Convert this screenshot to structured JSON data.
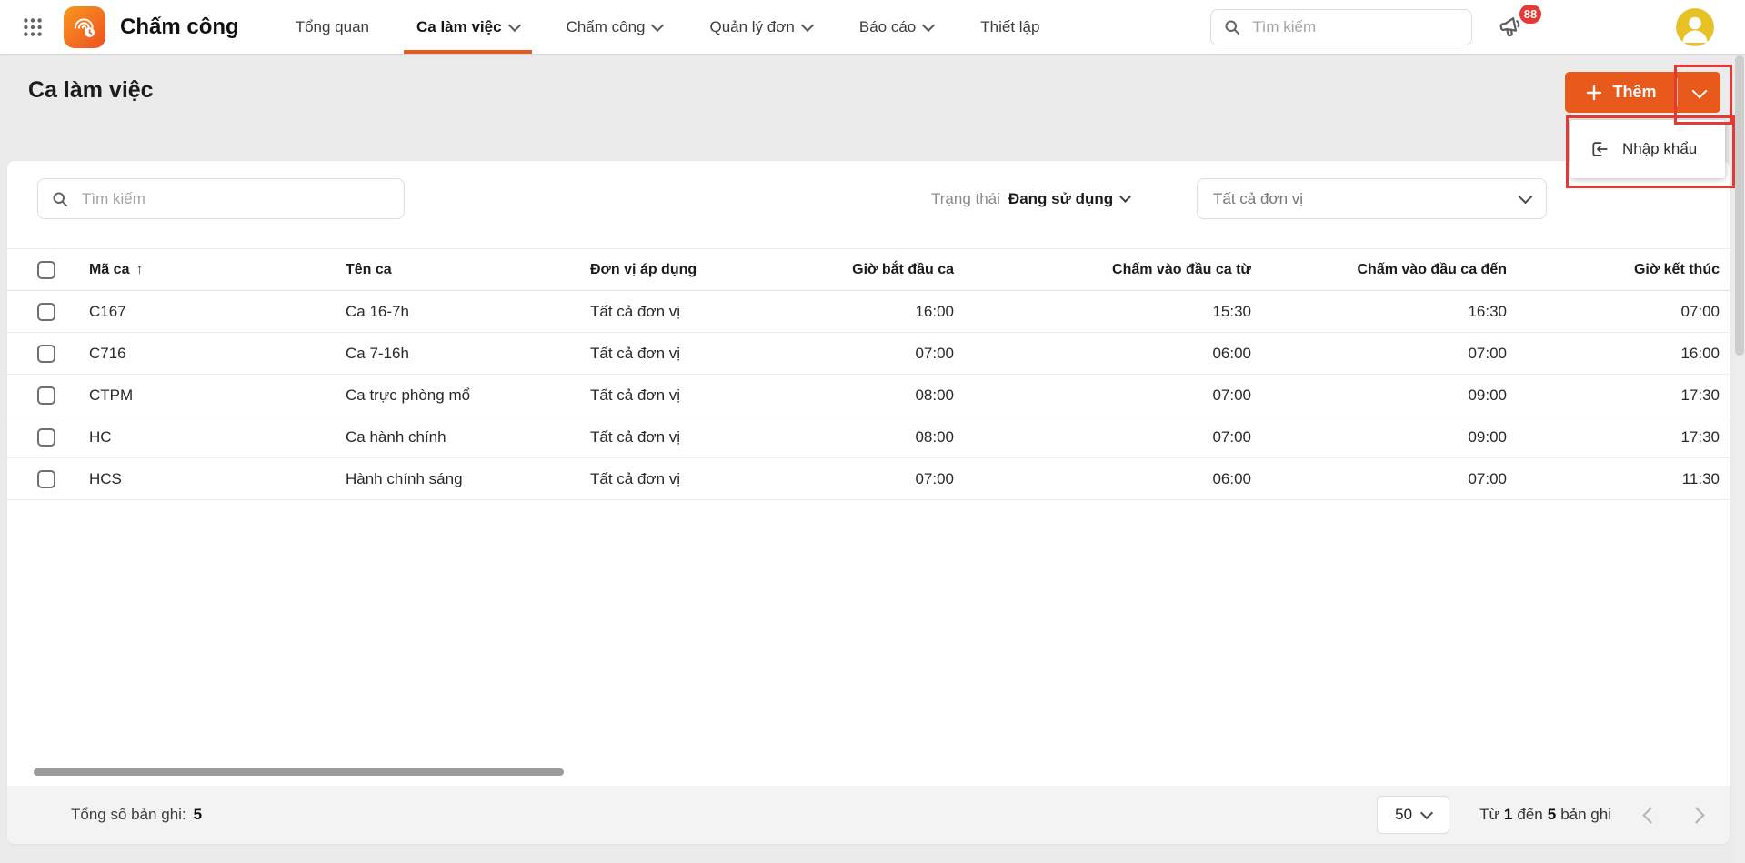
{
  "colors": {
    "accent_orange": "#e8591c",
    "annotation_red": "#e53935",
    "badge_red": "#e53935",
    "avatar_yellow": "#e6c227"
  },
  "icons": {
    "sort_ascending": "↑"
  },
  "topbar": {
    "app_title": "Chấm công",
    "nav": [
      {
        "label": "Tổng quan"
      },
      {
        "label": "Ca làm việc"
      },
      {
        "label": "Chấm công"
      },
      {
        "label": "Quản lý đơn"
      },
      {
        "label": "Báo cáo"
      },
      {
        "label": "Thiết lập"
      }
    ],
    "search_placeholder": "Tìm kiếm",
    "notification_badge": "88"
  },
  "page": {
    "title": "Ca làm việc",
    "add_button": "Thêm",
    "menu": {
      "import_label": "Nhập khẩu"
    }
  },
  "filters": {
    "search_placeholder": "Tìm kiếm",
    "status_label": "Trạng thái",
    "status_value": "Đang sử dụng",
    "unit_value": "Tất cả đơn vị"
  },
  "table": {
    "columns": [
      "Mã ca",
      "Tên ca",
      "Đơn vị áp dụng",
      "Giờ bắt đầu ca",
      "Chấm vào đầu ca từ",
      "Chấm vào đầu ca đến",
      "Giờ kết thúc"
    ],
    "rows": [
      {
        "code": "C167",
        "name": "Ca 16-7h",
        "unit": "Tất cả đơn vị",
        "start": "16:00",
        "checkin_from": "15:30",
        "checkin_to": "16:30",
        "end": "07:00"
      },
      {
        "code": "C716",
        "name": "Ca 7-16h",
        "unit": "Tất cả đơn vị",
        "start": "07:00",
        "checkin_from": "06:00",
        "checkin_to": "07:00",
        "end": "16:00"
      },
      {
        "code": "CTPM",
        "name": "Ca trực phòng mổ",
        "unit": "Tất cả đơn vị",
        "start": "08:00",
        "checkin_from": "07:00",
        "checkin_to": "09:00",
        "end": "17:30"
      },
      {
        "code": "HC",
        "name": "Ca hành chính",
        "unit": "Tất cả đơn vị",
        "start": "08:00",
        "checkin_from": "07:00",
        "checkin_to": "09:00",
        "end": "17:30"
      },
      {
        "code": "HCS",
        "name": "Hành chính sáng",
        "unit": "Tất cả đơn vị",
        "start": "07:00",
        "checkin_from": "06:00",
        "checkin_to": "07:00",
        "end": "11:30"
      }
    ]
  },
  "footer": {
    "total_label": "Tổng số bản ghi:",
    "total_value": "5",
    "page_size": "50",
    "range_prefix": "Từ",
    "range_from": "1",
    "range_mid": "đến",
    "range_to": "5",
    "range_suffix": "bản ghi"
  }
}
